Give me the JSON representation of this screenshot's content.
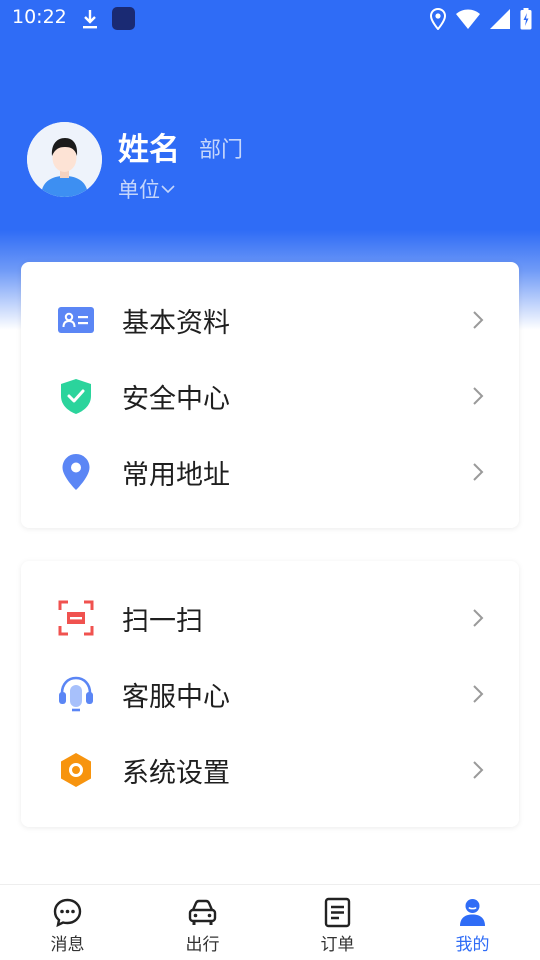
{
  "status_bar": {
    "time": "10:22"
  },
  "profile": {
    "name": "姓名",
    "department": "部门",
    "unit": "单位"
  },
  "menu_group_1": [
    {
      "label": "基本资料",
      "icon": "id-card-icon"
    },
    {
      "label": "安全中心",
      "icon": "shield-check-icon"
    },
    {
      "label": "常用地址",
      "icon": "location-pin-icon"
    }
  ],
  "menu_group_2": [
    {
      "label": "扫一扫",
      "icon": "scan-icon"
    },
    {
      "label": "客服中心",
      "icon": "headset-icon"
    },
    {
      "label": "系统设置",
      "icon": "settings-hexagon-icon"
    }
  ],
  "tabbar": [
    {
      "label": "消息",
      "icon": "message-icon",
      "active": false
    },
    {
      "label": "出行",
      "icon": "car-icon",
      "active": false
    },
    {
      "label": "订单",
      "icon": "order-icon",
      "active": false
    },
    {
      "label": "我的",
      "icon": "person-icon",
      "active": true
    }
  ],
  "colors": {
    "primary": "#2f6cf6",
    "shield": "#2bd49c",
    "scan": "#f0524f",
    "settings": "#f7940e",
    "text": "#1f1f1f"
  }
}
